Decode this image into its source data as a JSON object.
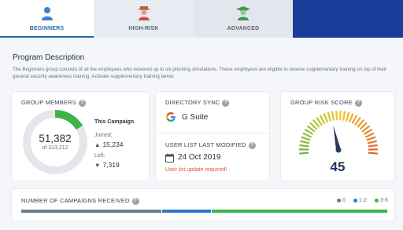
{
  "tabs": [
    {
      "label": "BEGINNERS",
      "icon": "user-icon",
      "active": true
    },
    {
      "label": "HIGH-RISK",
      "icon": "user-hat-icon",
      "active": false
    },
    {
      "label": "ADVANCED",
      "icon": "graduate-icon",
      "active": false
    }
  ],
  "program": {
    "title": "Program Description",
    "text": "The Beginners group consists of all the employees who received up to six phishing simulations. These employees are eligible to receive supplementary training on top of their general security awareness training. Activate supplementary training below."
  },
  "group_members": {
    "title": "GROUP MEMBERS",
    "count": "51,382",
    "total": "of 313,212",
    "fraction": 0.164,
    "campaign_label": "This Campaign",
    "joined_label": "Joined:",
    "joined_value": "15,234",
    "left_label": "Left:",
    "left_value": "7,319"
  },
  "directory_sync": {
    "title": "DIRECTORY SYNC",
    "provider": "G Suite",
    "modified_title": "USER LIST LAST MODIFIED",
    "modified_date": "24 Oct 2019",
    "warning": "User list update required!"
  },
  "risk": {
    "title": "GROUP RISK SCORE",
    "score": "45",
    "score_value": 45,
    "max": 100
  },
  "campaigns": {
    "title": "NUMBER OF CAMPAIGNS RECEIVED",
    "legend": [
      {
        "label": "0",
        "color": "#6b7b8c"
      },
      {
        "label": "1-2",
        "color": "#2b7bc4"
      },
      {
        "label": "3-6",
        "color": "#3cb44a"
      }
    ],
    "shares": [
      0.385,
      0.135,
      0.48
    ]
  },
  "colors": {
    "accent": "#2b67b5",
    "green": "#3cb44a",
    "navy": "#1b3d9a",
    "warning": "#e2553f"
  }
}
